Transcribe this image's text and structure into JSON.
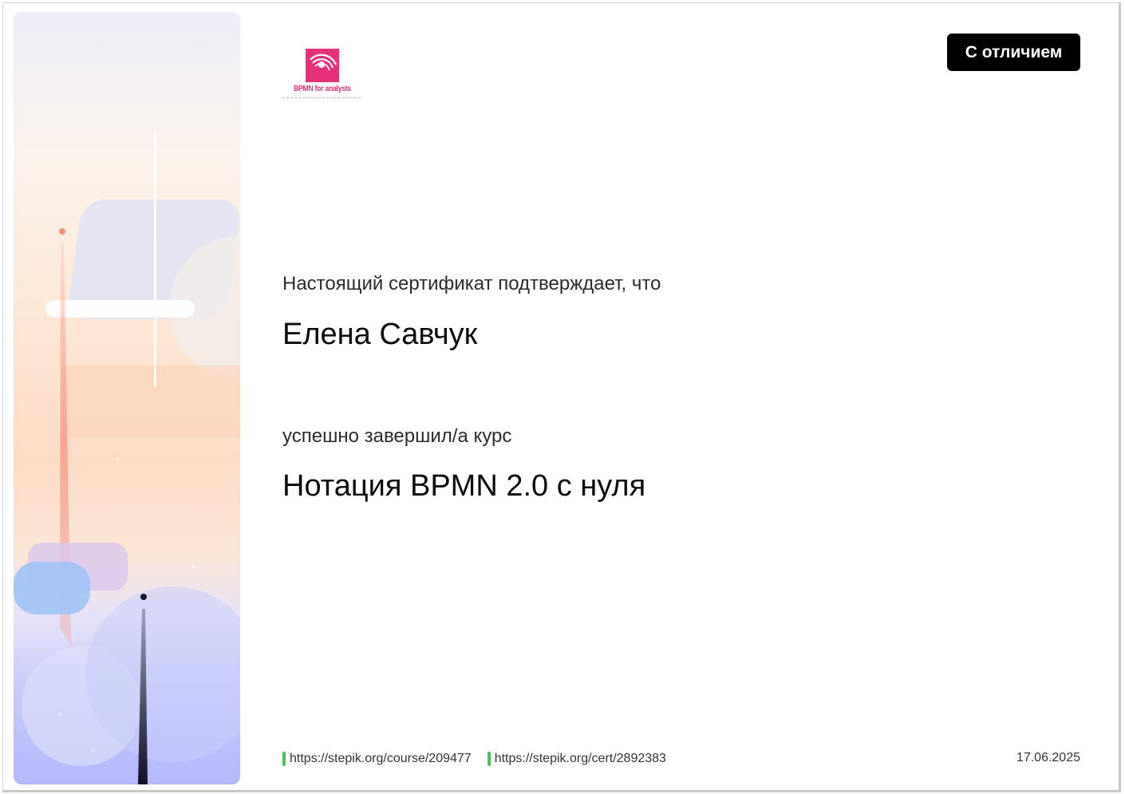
{
  "certificate": {
    "badge": "С отличием",
    "confirm_text": "Настоящий сертификат подтверждает, что",
    "recipient_name": "Елена Савчук",
    "completed_text": "успешно завершил/а  курс",
    "course_title": "Нотация BPMN 2.0 с нуля",
    "date": "17.06.2025"
  },
  "logo": {
    "text": "BPMN for analysts",
    "icon": "bpmn-logo-icon",
    "color": "#e6317a"
  },
  "links": [
    {
      "text": "https://stepik.org/course/209477"
    },
    {
      "text": "https://stepik.org/cert/2892383"
    }
  ],
  "colors": {
    "badge_background": "#000000",
    "link_marker": "#49c25c",
    "logo_pink": "#e6317a"
  }
}
